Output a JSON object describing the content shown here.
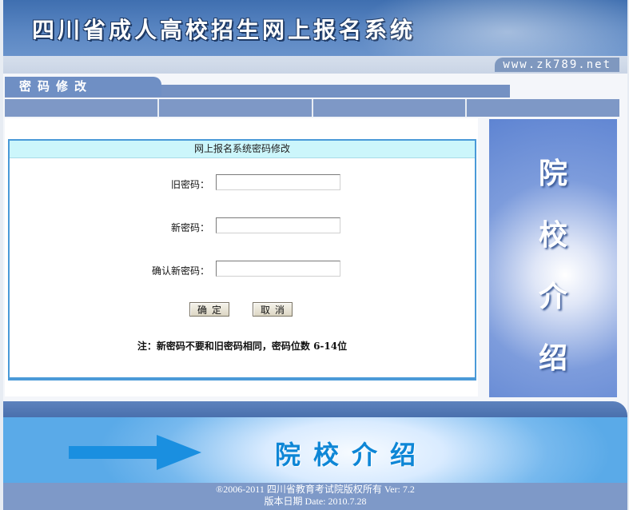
{
  "header": {
    "title": "四川省成人高校招生网上报名系统",
    "url": "www.zk789.net"
  },
  "section": {
    "title": "密码修改"
  },
  "nav": {
    "tabs": [
      "",
      "",
      "",
      ""
    ]
  },
  "form": {
    "heading": "网上报名系统密码修改",
    "old_password_label": "旧密码：",
    "old_password_value": "",
    "new_password_label": "新密码：",
    "new_password_value": "",
    "confirm_password_label": "确认新密码：",
    "confirm_password_value": "",
    "confirm_button": "确定",
    "cancel_button": "取消",
    "note": "注：新密码不要和旧密码相同，密码位数  6-14位"
  },
  "side": {
    "chars": [
      "院",
      "校",
      "介",
      "绍"
    ]
  },
  "promo": {
    "text": "院校介绍"
  },
  "footer": {
    "copyright": "®2006-2011 四川省教育考试院版权所有  Ver: 7.2",
    "version_date": "版本日期  Date: 2010.7.28"
  },
  "colors": {
    "banner": "#4f7dbb",
    "nav": "#7e98c6",
    "form_border": "#4a9ad8",
    "form_head_bg": "#ccf6fb",
    "promo_text": "#0d86d6"
  }
}
